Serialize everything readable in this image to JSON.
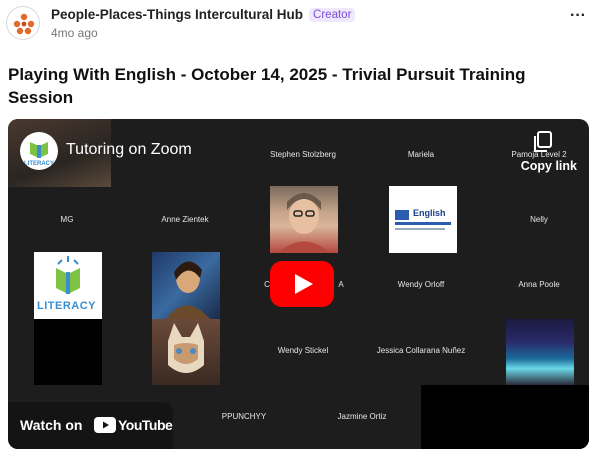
{
  "post": {
    "author": "People-Places-Things Intercultural Hub",
    "badge": "Creator",
    "time": "4mo ago",
    "more": "···",
    "title": "Playing With English - October 14, 2025 - Trivial Pursuit Training Session"
  },
  "video": {
    "title": "Tutoring on Zoom",
    "copy_label": "Copy link",
    "watch_label": "Watch on",
    "youtube_label": "YouTube",
    "participants": {
      "stephen": "Stephen Stolzberg",
      "mariela": "Mariela",
      "pamoja": "Pamoja Level 2",
      "mg": "MG",
      "anne": "Anne Zientek",
      "nelly": "Nelly",
      "wendy_orloff": "Wendy Orloff",
      "anna": "Anna Poole",
      "wendy_stickel": "Wendy Stickel",
      "jessica": "Jessica Collarana Nuñez",
      "ppunchyy": "PPUNCHYY",
      "jazmine": "Jazmine Ortiz",
      "partial_a": "C",
      "partial_b": "A"
    },
    "logo_text": "LITERACY",
    "english_tile_text": "English"
  },
  "colors": {
    "badge_text": "#7b4fd8",
    "play_red": "#ff0000",
    "video_bg": "#1d1d1d"
  }
}
